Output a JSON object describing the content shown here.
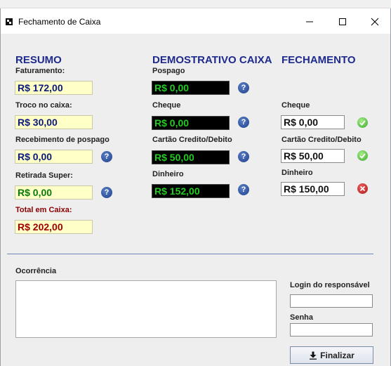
{
  "window": {
    "title": "Fechamento de Caixa",
    "icon": "app-icon",
    "controls": {
      "minimize": "minimize-icon",
      "maximize": "maximize-icon",
      "close": "close-icon"
    }
  },
  "resumo": {
    "heading": "RESUMO",
    "faturamento_label": "Faturamento:",
    "faturamento_value": "R$ 172,00",
    "troco_label": "Troco no caixa:",
    "troco_value": "R$ 30,00",
    "recebimento_label": "Recebimento de pospago",
    "recebimento_value": "R$ 0,00",
    "retirada_label": "Retirada Super:",
    "retirada_value": "R$ 0,00",
    "total_label": "Total em Caixa:",
    "total_value": "R$ 202,00"
  },
  "demonstrativo": {
    "heading": "DEMOSTRATIVO CAIXA",
    "pospago_label": "Pospago",
    "pospago_value": "R$ 0,00",
    "cheque_label": "Cheque",
    "cheque_value": "R$ 0,00",
    "cartao_label": "Cartão Credito/Debito",
    "cartao_value": "R$ 50,00",
    "dinheiro_label": "Dinheiro",
    "dinheiro_value": "R$ 152,00"
  },
  "fechamento": {
    "heading": "FECHAMENTO",
    "cheque_label": "Cheque",
    "cheque_value": "R$ 0,00",
    "cheque_status": "ok",
    "cartao_label": "Cartão Credito/Debito",
    "cartao_value": "R$ 50,00",
    "cartao_status": "ok",
    "dinheiro_label": "Dinheiro",
    "dinheiro_value": "R$ 150,00",
    "dinheiro_status": "error"
  },
  "ocorrencia": {
    "label": "Ocorrência",
    "value": ""
  },
  "login": {
    "label": "Login do responsável",
    "value": ""
  },
  "senha": {
    "label": "Senha",
    "value": ""
  },
  "finalizar": {
    "label": "Finalizar",
    "icon": "download-arrow-icon"
  },
  "colors": {
    "heading": "#1e2a8c",
    "total": "#8b0000",
    "help_icon": "#1f3f8a",
    "ok_icon": "#3aa62a",
    "error_icon": "#a81818"
  }
}
